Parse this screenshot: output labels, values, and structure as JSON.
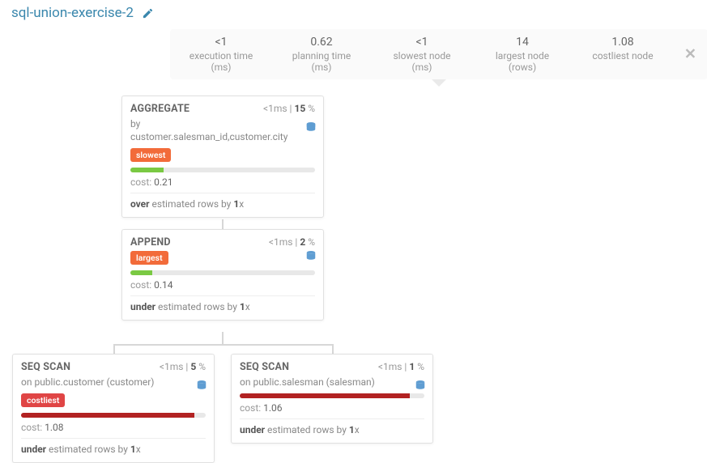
{
  "title": "sql-union-exercise-2",
  "stats": [
    {
      "value": "<1",
      "label": "execution time (ms)"
    },
    {
      "value": "0.62",
      "label": "planning time (ms)"
    },
    {
      "value": "<1",
      "label": "slowest node (ms)"
    },
    {
      "value": "14",
      "label": "largest node (rows)"
    },
    {
      "value": "1.08",
      "label": "costliest node"
    }
  ],
  "close_symbol": "✕",
  "labels": {
    "cost_prefix": "cost: ",
    "est_by": " estimated rows by ",
    "ms_sep": " | ",
    "pct_suffix": " %"
  },
  "nodes": {
    "aggregate": {
      "title": "AGGREGATE",
      "ms": "<1ms",
      "pct": "15",
      "sub_prefix": "by ",
      "sub_value": "customer.salesman_id,customer.city",
      "badge": "slowest",
      "bar_pct": 18,
      "bar_color": "green",
      "cost": "0.21",
      "est_dir": "over",
      "est_factor": "1",
      "est_suffix": "x"
    },
    "append": {
      "title": "APPEND",
      "ms": "<1ms",
      "pct": "2",
      "badge": "largest",
      "bar_pct": 12,
      "bar_color": "green",
      "cost": "0.14",
      "est_dir": "under",
      "est_factor": "1",
      "est_suffix": "x"
    },
    "seq_customer": {
      "title": "SEQ SCAN",
      "ms": "<1ms",
      "pct": "5",
      "sub_prefix": "on ",
      "sub_value": "public.customer (customer)",
      "badge": "costliest",
      "bar_pct": 94,
      "bar_color": "red",
      "cost": "1.08",
      "est_dir": "under",
      "est_factor": "1",
      "est_suffix": "x"
    },
    "seq_salesman": {
      "title": "SEQ SCAN",
      "ms": "<1ms",
      "pct": "1",
      "sub_prefix": "on ",
      "sub_value": "public.salesman (salesman)",
      "bar_pct": 92,
      "bar_color": "red",
      "cost": "1.06",
      "est_dir": "under",
      "est_factor": "1",
      "est_suffix": "x"
    }
  }
}
